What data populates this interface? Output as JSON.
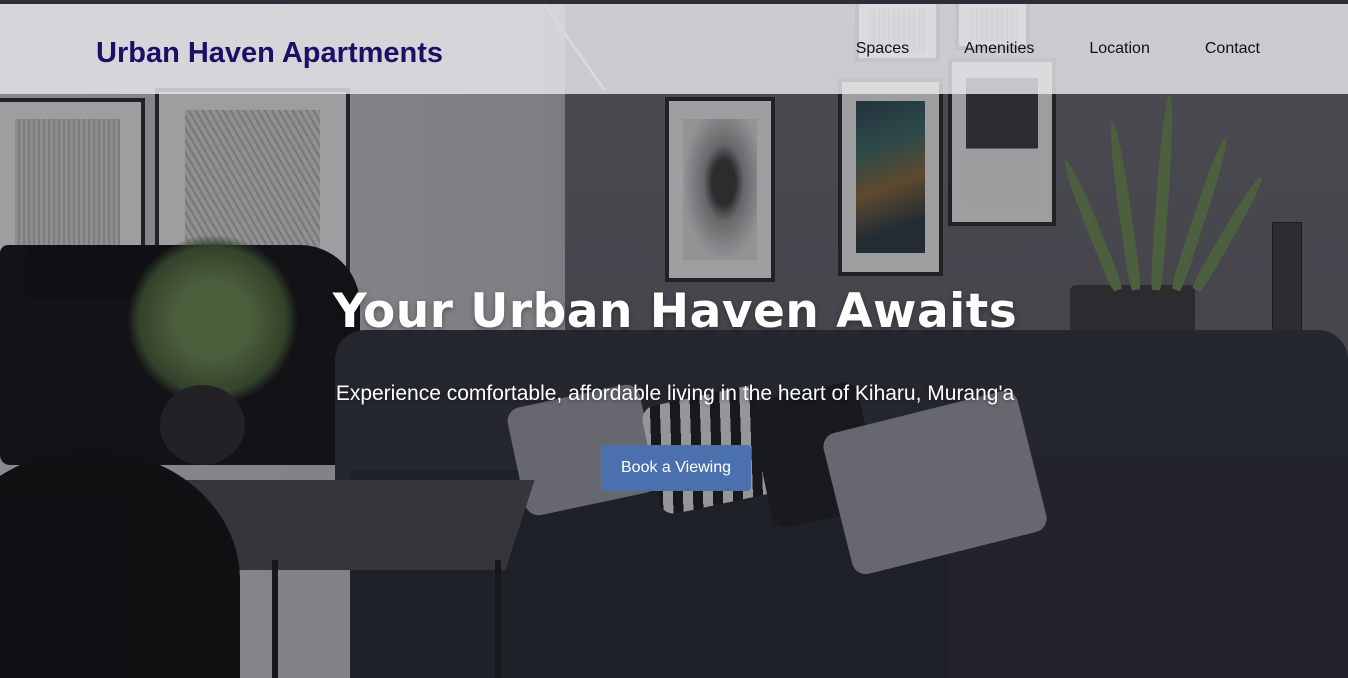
{
  "header": {
    "brand": "Urban Haven Apartments",
    "nav": [
      {
        "label": "Spaces"
      },
      {
        "label": "Amenities"
      },
      {
        "label": "Location"
      },
      {
        "label": "Contact"
      }
    ]
  },
  "hero": {
    "title": "Your Urban Haven Awaits",
    "subtitle": "Experience comfortable, affordable living in the heart of Kiharu, Murang'a",
    "cta_label": "Book a Viewing",
    "background_image": "living-room-photo"
  },
  "colors": {
    "brand": "#1c0f66",
    "cta": "#4a70ad",
    "header_bg": "#e8e8ec"
  }
}
